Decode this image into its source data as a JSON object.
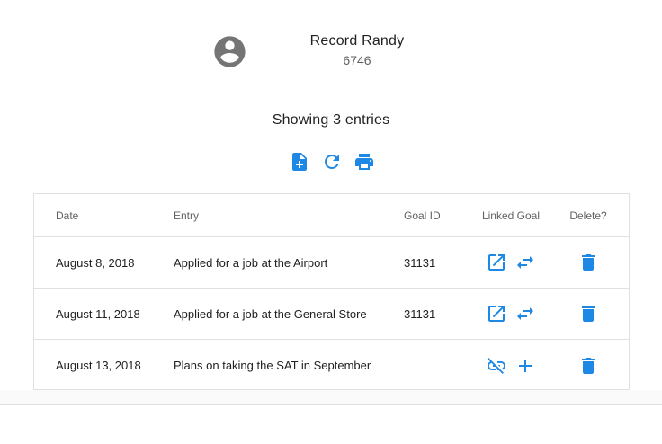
{
  "user": {
    "name": "Record Randy",
    "id": "6746",
    "avatar_icon": "account-circle-icon"
  },
  "summary": "Showing 3 entries",
  "toolbar": [
    {
      "name": "add-entry",
      "icon": "note-add-icon"
    },
    {
      "name": "refresh",
      "icon": "refresh-icon"
    },
    {
      "name": "print",
      "icon": "print-icon"
    }
  ],
  "table": {
    "headers": {
      "date": "Date",
      "entry": "Entry",
      "goal_id": "Goal ID",
      "linked_goal": "Linked Goal",
      "delete": "Delete?"
    },
    "rows": [
      {
        "date": "August 8, 2018",
        "entry": "Applied for a job at the Airport",
        "goal_id": "31131",
        "linked": true
      },
      {
        "date": "August 11, 2018",
        "entry": "Applied for a job at the General Store",
        "goal_id": "31131",
        "linked": true
      },
      {
        "date": "August 13, 2018",
        "entry": "Plans on taking the SAT in September",
        "goal_id": "",
        "linked": false
      }
    ]
  },
  "colors": {
    "accent": "#1e88e5",
    "avatar": "#757575"
  }
}
